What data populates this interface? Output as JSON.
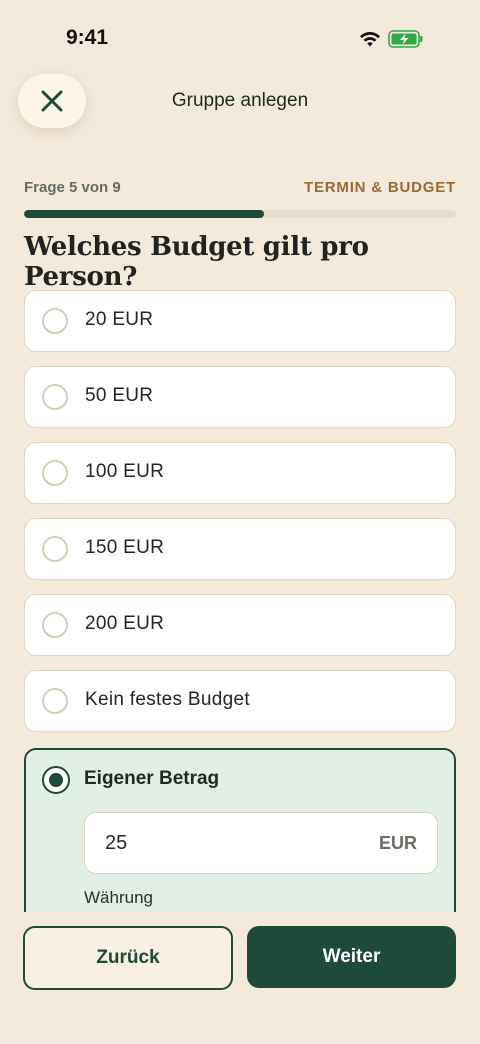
{
  "status_bar": {
    "time": "9:41",
    "wifi_icon": "wifi-icon",
    "battery_icon": "battery-charging-icon"
  },
  "header": {
    "title": "Gruppe anlegen",
    "close_icon": "close-icon"
  },
  "progress": {
    "step_label": "Frage 5 von 9",
    "section_label": "TERMIN & BUDGET",
    "current": 5,
    "total": 9,
    "fraction": 0.556
  },
  "question": "Welches Budget gilt pro Person?",
  "options": [
    {
      "label": "20 EUR",
      "selected": false
    },
    {
      "label": "50 EUR",
      "selected": false
    },
    {
      "label": "100 EUR",
      "selected": false
    },
    {
      "label": "150 EUR",
      "selected": false
    },
    {
      "label": "200 EUR",
      "selected": false
    },
    {
      "label": "Kein festes Budget",
      "selected": false
    }
  ],
  "custom": {
    "label": "Eigener Betrag",
    "selected": true,
    "amount": "25",
    "unit": "EUR",
    "currency_label": "Währung"
  },
  "footer": {
    "back_label": "Zurück",
    "next_label": "Weiter"
  },
  "colors": {
    "background": "#f4eadc",
    "primary": "#1e4a3a",
    "accent": "#9a6a32",
    "selected_bg": "#e2efe5"
  }
}
